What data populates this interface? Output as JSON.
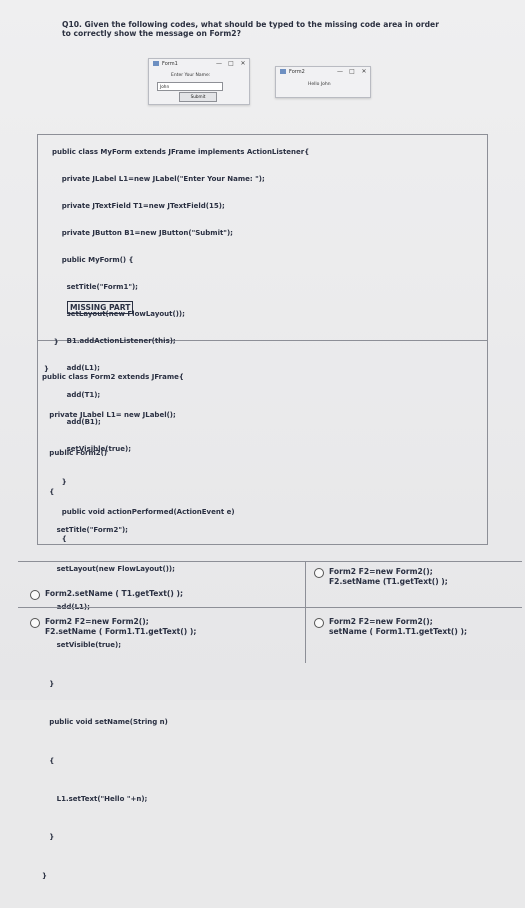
{
  "question": {
    "text": "Q10. Given the following codes, what should be typed to the missing code area in order to correctly show the message on Form2?"
  },
  "form1_window": {
    "title": "Form1",
    "label": "Enter Your Name:",
    "field_value": "John",
    "button": "Submit",
    "controls": [
      "—",
      "□",
      "✕"
    ]
  },
  "form2_window": {
    "title": "Form2",
    "label": "Hello John",
    "controls": [
      "—",
      "□",
      "✕"
    ]
  },
  "code_form1": [
    "public class MyForm extends JFrame implements ActionListener{",
    "    private JLabel L1=new JLabel(\"Enter Your Name: \");",
    "    private JTextField T1=new JTextField(15);",
    "    private JButton B1=new JButton(\"Submit\");",
    "    public MyForm() {",
    "      setTitle(\"Form1\");",
    "      setLayout(new FlowLayout());",
    "      B1.addActionListener(this);",
    "      add(L1);",
    "      add(T1);",
    "      add(B1);",
    "      setVisible(true);",
    "    }",
    "    public void actionPerformed(ActionEvent e)",
    "    {"
  ],
  "missing_label": "MISSING PART",
  "code_form1_end": [
    "    }",
    "}"
  ],
  "code_form2": [
    "public class Form2 extends JFrame{",
    "   private JLabel L1= new JLabel();",
    "   public Form2()",
    "   {",
    "      setTitle(\"Form2\");",
    "      setLayout(new FlowLayout());",
    "      add(L1);",
    "      setVisible(true);",
    "   }",
    "   public void setName(String n)",
    "   {",
    "      L1.setText(\"Hello \"+n);",
    "   }",
    "}"
  ],
  "options": [
    "Form2.setName ( T1.getText() );",
    "Form2 F2=new Form2();\nF2.setName (T1.getText() );",
    "Form2 F2=new Form2();\nF2.setName ( Form1.T1.getText() );",
    "Form2 F2=new Form2();\nsetName ( Form1.T1.getText() );"
  ]
}
